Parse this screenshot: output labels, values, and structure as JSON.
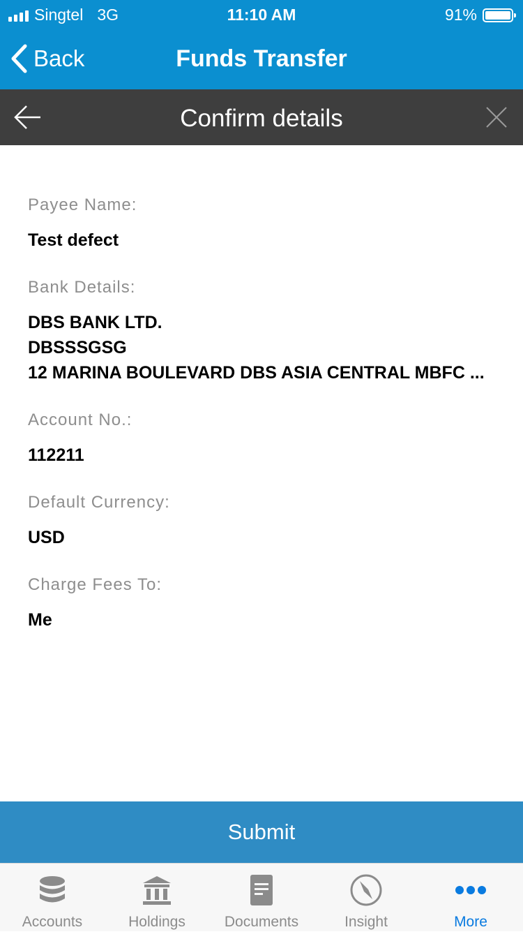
{
  "status_bar": {
    "carrier": "Singtel",
    "network": "3G",
    "time": "11:10 AM",
    "battery": "91%"
  },
  "nav": {
    "back_label": "Back",
    "title": "Funds Transfer"
  },
  "subheader": {
    "title": "Confirm details"
  },
  "details": {
    "payee_name_label": "Payee Name:",
    "payee_name_value": "Test defect",
    "bank_details_label": "Bank Details:",
    "bank_name": "DBS BANK LTD.",
    "bank_swift": "DBSSSGSG",
    "bank_address": "12 MARINA BOULEVARD DBS ASIA CENTRAL MBFC ...",
    "account_no_label": "Account No.:",
    "account_no_value": "112211",
    "currency_label": "Default Currency:",
    "currency_value": "USD",
    "charge_fees_label": "Charge Fees To:",
    "charge_fees_value": "Me"
  },
  "submit_label": "Submit",
  "tabs": [
    {
      "label": "Accounts",
      "icon": "database-icon"
    },
    {
      "label": "Holdings",
      "icon": "bank-building-icon"
    },
    {
      "label": "Documents",
      "icon": "document-icon"
    },
    {
      "label": "Insight",
      "icon": "compass-icon"
    },
    {
      "label": "More",
      "icon": "more-dots-icon",
      "active": true
    }
  ],
  "colors": {
    "brand_blue": "#0b8fd0",
    "subheader_dark": "#3e3e3e",
    "submit_blue": "#2f8cc4",
    "active_tab": "#0a7be0"
  }
}
